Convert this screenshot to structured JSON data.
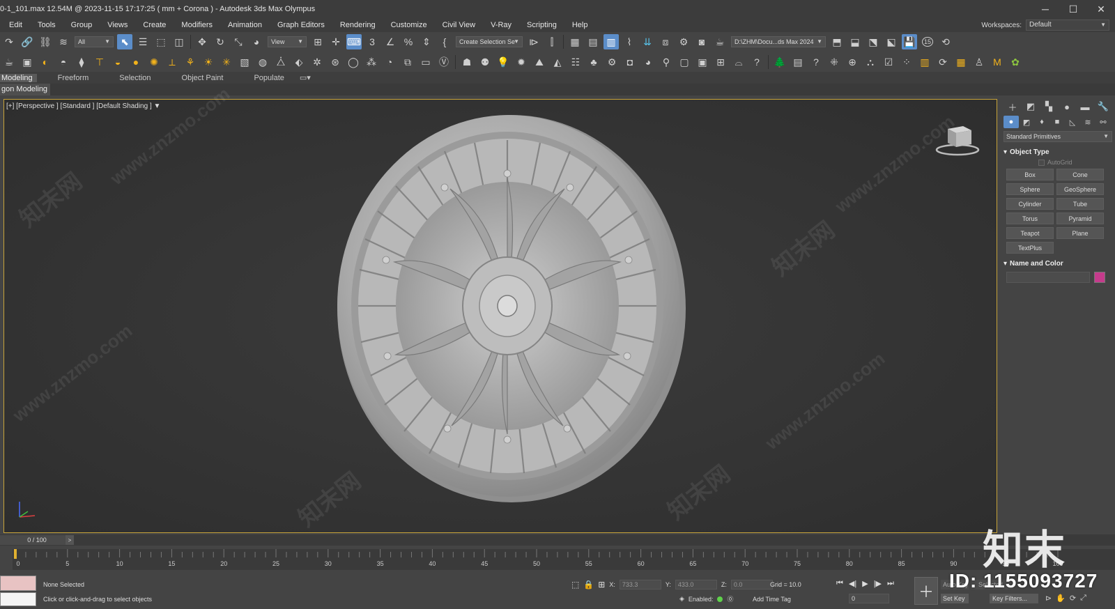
{
  "window": {
    "title": "0-1_101.max  12.54M @ 2023-11-15 17:17:25  ( mm + Corona ) - Autodesk 3ds Max Olympus",
    "minimize": "─",
    "maximize": "☐",
    "close": "✕"
  },
  "menu": [
    "Edit",
    "Tools",
    "Group",
    "Views",
    "Create",
    "Modifiers",
    "Animation",
    "Graph Editors",
    "Rendering",
    "Customize",
    "Civil View",
    "V-Ray",
    "Scripting",
    "Help"
  ],
  "workspaces": {
    "label": "Workspaces:",
    "value": "Default"
  },
  "toolbar1": {
    "selection_filter": "All",
    "ref_coord": "View",
    "snap_number": "3",
    "named_selection": "Create Selection Se",
    "project_path": "D:\\ZHM\\Docu...ds Max 2024",
    "badge": "15"
  },
  "ribbon": {
    "tabs": [
      "Modeling",
      "Freeform",
      "Selection",
      "Object Paint",
      "Populate"
    ],
    "sub": "gon Modeling"
  },
  "viewport": {
    "label": "[+] [Perspective ] [Standard ] [Default Shading ]"
  },
  "command_panel": {
    "category": "Standard Primitives",
    "object_type_title": "Object Type",
    "autogrid": "AutoGrid",
    "buttons": [
      "Box",
      "Cone",
      "Sphere",
      "GeoSphere",
      "Cylinder",
      "Tube",
      "Torus",
      "Pyramid",
      "Teapot",
      "Plane",
      "TextPlus"
    ],
    "name_color_title": "Name and Color",
    "swatch_color": "#c53b8c"
  },
  "timeline": {
    "frame_display": "0 / 100",
    "next": ">",
    "ticks": [
      "0",
      "5",
      "10",
      "15",
      "20",
      "25",
      "30",
      "35",
      "40",
      "45",
      "50",
      "55",
      "60",
      "65",
      "70",
      "75",
      "80",
      "85",
      "90",
      "95",
      "100"
    ]
  },
  "status": {
    "selection": "None Selected",
    "prompt": "Click or click-and-drag to select objects",
    "x_label": "X:",
    "x_value": "733.3",
    "y_label": "Y:",
    "y_value": "433.0",
    "z_label": "Z:",
    "z_value": "0.0",
    "grid": "Grid = 10.0",
    "enabled": "Enabled:",
    "add_time_tag": "Add Time Tag",
    "current_frame": "0",
    "auto_key": "Auto Key",
    "selected": "Selected",
    "set_key": "Set Key",
    "key_filters": "Key Filters..."
  },
  "watermark": {
    "logo": "知末",
    "id": "ID: 1155093727",
    "site": "www.znzmo.com",
    "brand": "知末网"
  }
}
